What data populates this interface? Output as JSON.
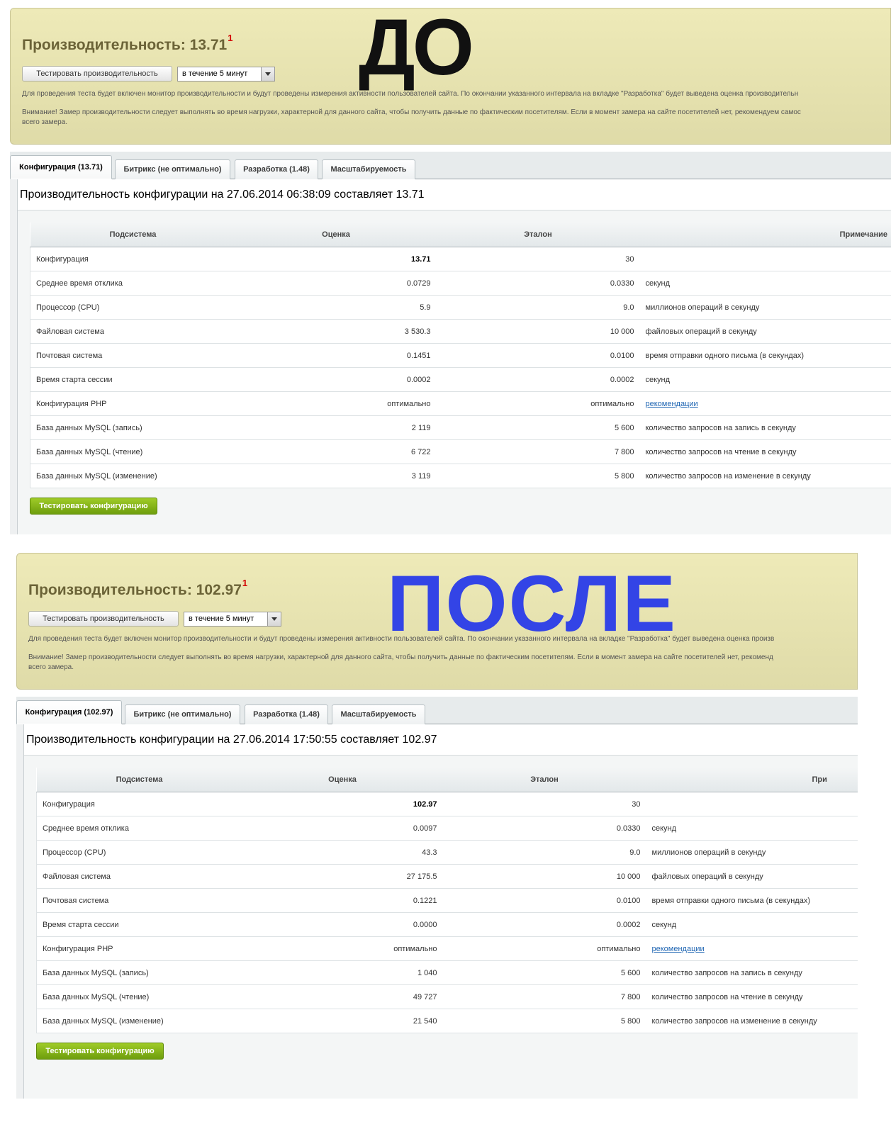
{
  "panels": {
    "before": {
      "big_label": "ДО",
      "perf_title": "Производительность: 13.71",
      "footnote": "1",
      "test_button": "Тестировать производительность",
      "interval": "в течение 5 минут",
      "desc1": "Для проведения теста будет включен монитор производительности и будут проведены измерения активности пользователей сайта. По окончании указанного интервала на вкладке \"Разработка\" будет выведена оценка производительн",
      "desc2_line1": "Внимание! Замер производительности следует выполнять во время нагрузки, характерной для данного сайта, чтобы получить данные по фактическим посетителям. Если в момент замера на сайте посетителей нет, рекомендуем самос",
      "desc2_line2": "всего замера.",
      "tabs": [
        "Конфигурация (13.71)",
        "Битрикс (не оптимально)",
        "Разработка (1.48)",
        "Масштабируемость"
      ],
      "config_title": "Производительность конфигурации на 27.06.2014 06:38:09 составляет 13.71",
      "columns": [
        "Подсистема",
        "Оценка",
        "Эталон",
        "Примечание"
      ],
      "rows": [
        {
          "name": "Конфигурация",
          "score": "13.71",
          "ref": "30",
          "note": ""
        },
        {
          "name": "Среднее время отклика",
          "score": "0.0729",
          "ref": "0.0330",
          "note": "секунд"
        },
        {
          "name": "Процессор (CPU)",
          "score": "5.9",
          "ref": "9.0",
          "note": "миллионов операций в секунду"
        },
        {
          "name": "Файловая система",
          "score": "3 530.3",
          "ref": "10 000",
          "note": "файловых операций в секунду"
        },
        {
          "name": "Почтовая система",
          "score": "0.1451",
          "ref": "0.0100",
          "note": "время отправки одного письма (в секундах)"
        },
        {
          "name": "Время старта сессии",
          "score": "0.0002",
          "ref": "0.0002",
          "note": "секунд"
        },
        {
          "name": "Конфигурация PHP",
          "score": "оптимально",
          "ref": "оптимально",
          "note": "рекомендации"
        },
        {
          "name": "База данных MySQL (запись)",
          "score": "2 119",
          "ref": "5 600",
          "note": "количество запросов на запись в секунду"
        },
        {
          "name": "База данных MySQL (чтение)",
          "score": "6 722",
          "ref": "7 800",
          "note": "количество запросов на чтение в секунду"
        },
        {
          "name": "База данных MySQL (изменение)",
          "score": "3 119",
          "ref": "5 800",
          "note": "количество запросов на изменение в секунду"
        }
      ],
      "test_config_button": "Тестировать конфигурацию"
    },
    "after": {
      "big_label": "ПОСЛЕ",
      "perf_title": "Производительность: 102.97",
      "footnote": "1",
      "test_button": "Тестировать производительность",
      "interval": "в течение 5 минут",
      "desc1": "Для проведения теста будет включен монитор производительности и будут проведены измерения активности пользователей сайта. По окончании указанного интервала на вкладке \"Разработка\" будет выведена оценка произв",
      "desc2_line1": "Внимание! Замер производительности следует выполнять во время нагрузки, характерной для данного сайта, чтобы получить данные по фактическим посетителям. Если в момент замера на сайте посетителей нет, рекоменд",
      "desc2_line2": "всего замера.",
      "tabs": [
        "Конфигурация (102.97)",
        "Битрикс (не оптимально)",
        "Разработка (1.48)",
        "Масштабируемость"
      ],
      "config_title": "Производительность конфигурации на 27.06.2014 17:50:55 составляет 102.97",
      "columns": [
        "Подсистема",
        "Оценка",
        "Эталон",
        "При"
      ],
      "rows": [
        {
          "name": "Конфигурация",
          "score": "102.97",
          "ref": "30",
          "note": ""
        },
        {
          "name": "Среднее время отклика",
          "score": "0.0097",
          "ref": "0.0330",
          "note": "секунд"
        },
        {
          "name": "Процессор (CPU)",
          "score": "43.3",
          "ref": "9.0",
          "note": "миллионов операций в секунду"
        },
        {
          "name": "Файловая система",
          "score": "27 175.5",
          "ref": "10 000",
          "note": "файловых операций в секунду"
        },
        {
          "name": "Почтовая система",
          "score": "0.1221",
          "ref": "0.0100",
          "note": "время отправки одного письма (в секундах)"
        },
        {
          "name": "Время старта сессии",
          "score": "0.0000",
          "ref": "0.0002",
          "note": "секунд"
        },
        {
          "name": "Конфигурация PHP",
          "score": "оптимально",
          "ref": "оптимально",
          "note": "рекомендации"
        },
        {
          "name": "База данных MySQL (запись)",
          "score": "1 040",
          "ref": "5 600",
          "note": "количество запросов на запись в секунду"
        },
        {
          "name": "База данных MySQL (чтение)",
          "score": "49 727",
          "ref": "7 800",
          "note": "количество запросов на чтение в секунду"
        },
        {
          "name": "База данных MySQL (изменение)",
          "score": "21 540",
          "ref": "5 800",
          "note": "количество запросов на изменение в секунду"
        }
      ],
      "test_config_button": "Тестировать конфигурацию"
    }
  },
  "colors": {
    "header_bg": "#e6e2b0",
    "title_text": "#6b6337",
    "footnote": "#d20000",
    "label_before": "#111111",
    "label_after": "#3344e6",
    "green_button": "#7fb11a",
    "link": "#2066b3"
  }
}
